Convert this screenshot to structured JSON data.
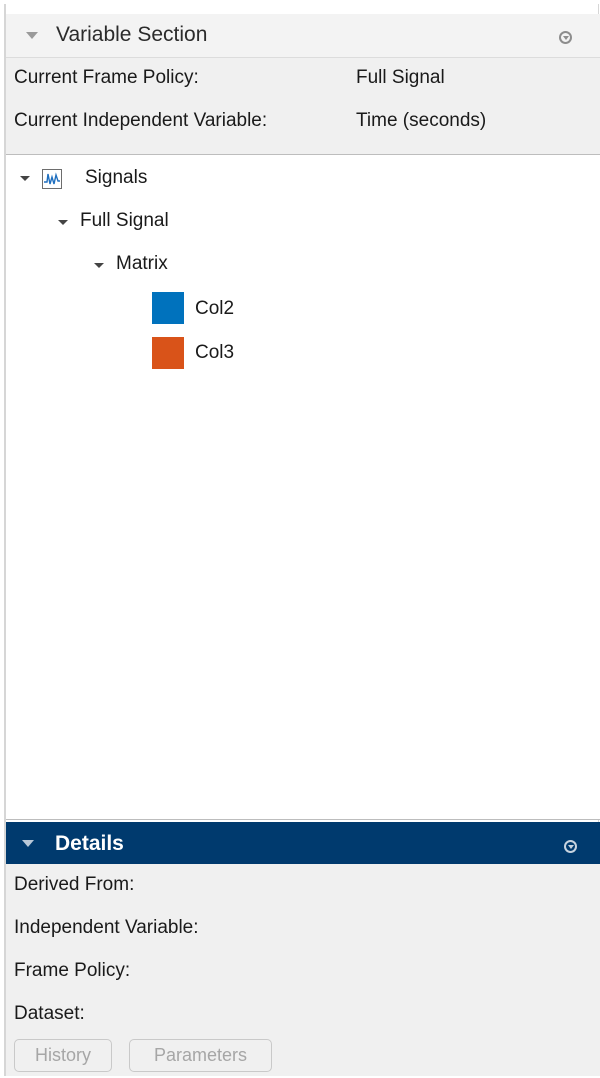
{
  "variable_section": {
    "title": "Variable Section",
    "frame_policy_label": "Current Frame Policy:",
    "frame_policy_value": "Full Signal",
    "independent_variable_label": "Current Independent Variable:",
    "independent_variable_value": "Time (seconds)"
  },
  "tree": {
    "root_label": "Signals",
    "child_label": "Full Signal",
    "grandchild_label": "Matrix",
    "leaves": [
      {
        "label": "Col2",
        "color": "#0072bd"
      },
      {
        "label": "Col3",
        "color": "#d95319"
      }
    ]
  },
  "details": {
    "title": "Details",
    "derived_from_label": "Derived From:",
    "independent_variable_label": "Independent Variable:",
    "frame_policy_label": "Frame Policy:",
    "dataset_label": "Dataset:",
    "history_button": "History",
    "parameters_button": "Parameters"
  },
  "colors": {
    "details_header_bg": "#003a6e",
    "panel_bg": "#f0f0f0"
  }
}
